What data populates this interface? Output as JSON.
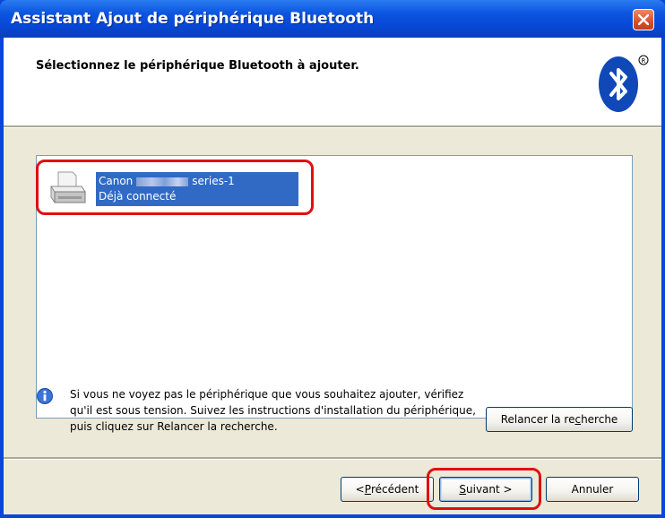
{
  "window": {
    "title": "Assistant Ajout de périphérique Bluetooth"
  },
  "header": {
    "title": "Sélectionnez le périphérique Bluetooth à ajouter."
  },
  "devices": [
    {
      "name_prefix": "Canon",
      "name_suffix": "series-1",
      "status": "Déjà connecté",
      "icon": "printer-icon",
      "selected": true
    }
  ],
  "info": {
    "icon": "info-icon",
    "text": "Si vous ne voyez pas le périphérique que vous souhaitez ajouter, vérifiez qu'il est sous tension. Suivez les instructions d'installation du périphérique, puis cliquez sur Relancer la recherche."
  },
  "buttons": {
    "rescan": {
      "before": "Relancer la re",
      "access": "c",
      "after": "herche"
    },
    "back": {
      "before": "< ",
      "access": "P",
      "after": "récédent"
    },
    "next": {
      "before": "",
      "access": "S",
      "after": "uivant >"
    },
    "cancel": {
      "label": "Annuler"
    }
  },
  "colors": {
    "titlebar": "#0a46d8",
    "selection": "#316ac5",
    "highlight_circle": "#e01010",
    "bluetooth_blue": "#1048b8"
  }
}
